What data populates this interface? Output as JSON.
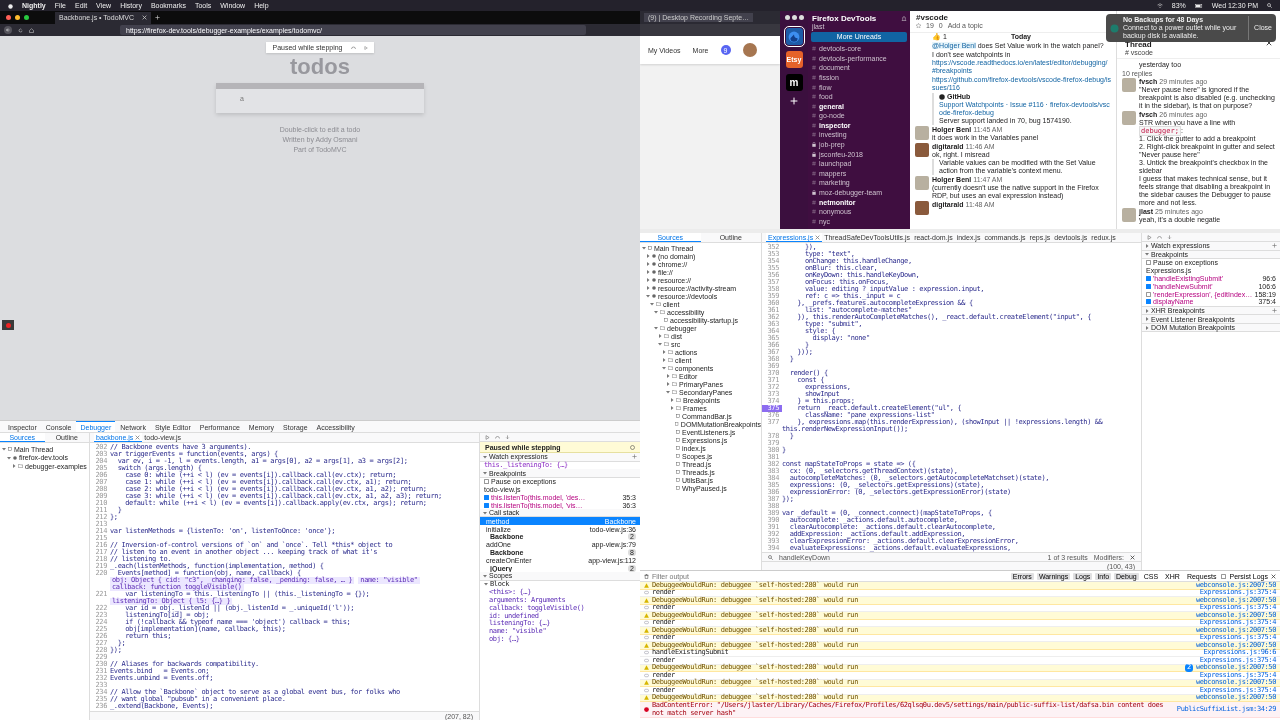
{
  "menubar": {
    "app": "Nightly",
    "menus": [
      "File",
      "Edit",
      "View",
      "History",
      "Bookmarks",
      "Tools",
      "Window",
      "Help"
    ],
    "battery": "83%",
    "clock": "Wed 12:30 PM"
  },
  "notification": {
    "title": "No Backups for 48 Days",
    "body": "Connect to a power outlet while your backup disk is available.",
    "button": "Close"
  },
  "browser": {
    "tab": "Backbone.js • TodoMVC",
    "url": "https://firefox-dev.tools/debugger-examples/examples/todomvc/",
    "paused_overlay": "Paused while stepping",
    "heading": "todos",
    "input_value": "a",
    "footer": [
      "Double-click to edit a todo",
      "Written by Addy Osmani",
      "Part of TodoMVC"
    ]
  },
  "toolbox": {
    "tabs": [
      {
        "label": "Inspector",
        "selected": false
      },
      {
        "label": "Console",
        "selected": false
      },
      {
        "label": "Debugger",
        "selected": true
      },
      {
        "label": "Network",
        "selected": false
      },
      {
        "label": "Style Editor",
        "selected": false
      },
      {
        "label": "Performance",
        "selected": false
      },
      {
        "label": "Memory",
        "selected": false
      },
      {
        "label": "Storage",
        "selected": false
      },
      {
        "label": "Accessibility",
        "selected": false
      }
    ],
    "sources_tabs": [
      {
        "label": "Sources",
        "selected": true
      },
      {
        "label": "Outline",
        "selected": false
      }
    ],
    "tree": [
      {
        "label": "Main Thread",
        "kind": "thread",
        "expanded": true,
        "children": [
          {
            "label": "firefox-dev.tools",
            "kind": "domain",
            "expanded": true,
            "children": [
              {
                "label": "debugger-examples",
                "kind": "folder",
                "expanded": false
              }
            ]
          }
        ]
      }
    ],
    "editor_tabs": [
      {
        "label": "backbone.js",
        "selected": true
      },
      {
        "label": "todo-view.js",
        "selected": false
      }
    ],
    "lines": [
      {
        "n": "202",
        "t": "// Backbone events have 3 arguments)."
      },
      {
        "n": "203",
        "t": "var triggerEvents = function(events, args) {"
      },
      {
        "n": "204",
        "t": "  var ev, i = -1, l = events.length, a1 = args[0], a2 = args[1], a3 = args[2];"
      },
      {
        "n": "205",
        "t": "  switch (args.length) {"
      },
      {
        "n": "206",
        "t": "    case 0: while (++i < l) (ev = events[i]).callback.call(ev.ctx); return;"
      },
      {
        "n": "207",
        "t": "    case 1: while (++i < l) (ev = events[i]).callback.call(ev.ctx, a1); return;"
      },
      {
        "n": "208",
        "t": "    case 2: while (++i < l) (ev = events[i]).callback.call(ev.ctx, a1, a2); return;"
      },
      {
        "n": "209",
        "t": "    case 3: while (++i < l) (ev = events[i]).callback.call(ev.ctx, a1, a2, a3); return;"
      },
      {
        "n": "210",
        "t": "    default: while (++i < l) (ev = events[i]).callback.apply(ev.ctx, args); return;"
      },
      {
        "n": "211",
        "t": "  }"
      },
      {
        "n": "212",
        "t": "};"
      },
      {
        "n": "213"
      },
      {
        "n": "214",
        "t": "var listenMethods = {listenTo: 'on', listenToOnce: 'once'};"
      },
      {
        "n": "215"
      },
      {
        "n": "216",
        "t": "// Inversion-of-control versions of `on` and `once`. Tell *this* object to"
      },
      {
        "n": "217",
        "t": "// listen to an event in another object ... keeping track of what it's"
      },
      {
        "n": "218",
        "t": "// listening to."
      },
      {
        "n": "219",
        "t": "_.each(listenMethods, function(implementation, method) {"
      },
      {
        "n": "220",
        "t": "  Events[method] = function(obj, name, callback) {",
        "previews": [
          "obj: Object { cid: \"c3\", _changing: false, _pending: false, … }",
          "name: \"visible\"",
          "callback: function toggleVisible()"
        ]
      },
      {
        "n": "221",
        "t": "    var listeningTo = this._listeningTo || (this._listeningTo = {});",
        "previews": [
          "listeningTo: Object { l5: {…} }"
        ]
      },
      {
        "n": "222",
        "t": "    var id = obj._listenId || (obj._listenId = _.uniqueId('l'));"
      },
      {
        "n": "223",
        "t": "    listeningTo[id] = obj;"
      },
      {
        "n": "224",
        "t": "    if (!callback && typeof name === 'object') callback = this;"
      },
      {
        "n": "225",
        "t": "    obj[implementation](name, callback, this);"
      },
      {
        "n": "226",
        "t": "    return this;"
      },
      {
        "n": "227",
        "t": "  };"
      },
      {
        "n": "228",
        "t": "});"
      },
      {
        "n": "229"
      },
      {
        "n": "230",
        "t": "// Aliases for backwards compatibility."
      },
      {
        "n": "231",
        "t": "Events.bind   = Events.on;"
      },
      {
        "n": "232",
        "t": "Events.unbind = Events.off;"
      },
      {
        "n": "233"
      },
      {
        "n": "234",
        "t": "// Allow the `Backbone` object to serve as a global event bus, for folks who"
      },
      {
        "n": "235",
        "t": "// want global \"pubsub\" in a convenient place."
      },
      {
        "n": "236",
        "t": "_.extend(Backbone, Events);"
      }
    ],
    "cursor": "(207, 82)",
    "pause_banner": "Paused while stepping",
    "watch": {
      "title": "Watch expressions",
      "items": [
        "this._listeningTo: {…}"
      ]
    },
    "breakpoints": {
      "title": "Breakpoints",
      "pause_label": "Pause on exceptions",
      "pause_checked": false,
      "file": "todo-view.js",
      "items": [
        {
          "text": "this.listenTo(this.model, 'des…",
          "loc": "35:3",
          "checked": true
        },
        {
          "text": "this.listenTo(this.model, 'vis…",
          "loc": "36:3",
          "checked": true
        }
      ]
    },
    "callstack": {
      "title": "Call stack",
      "frames": [
        {
          "name": "method",
          "loc": "Backbone",
          "kind": "group",
          "selected": true
        },
        {
          "name": "initialize",
          "loc": "todo-view.js:36",
          "kind": "frame",
          "selected": false
        },
        {
          "name": "Backbone",
          "loc": "2",
          "kind": "group",
          "selected": false
        },
        {
          "name": "addOne",
          "loc": "app-view.js:79",
          "kind": "frame",
          "selected": false
        },
        {
          "name": "Backbone",
          "loc": "8",
          "kind": "group",
          "selected": false
        },
        {
          "name": "createOnEnter",
          "loc": "app-view.js:112",
          "kind": "frame",
          "selected": false
        },
        {
          "name": "jQuery",
          "loc": "2",
          "kind": "group",
          "selected": false
        }
      ]
    },
    "scopes": {
      "title": "Scopes",
      "block": "Block",
      "items": [
        "<this>: {…}",
        "arguments: Arguments",
        "callback: toggleVisible()",
        "id: undefined",
        "listeningTo: {…}",
        "name: \"visible\"",
        "obj: {…}"
      ]
    }
  },
  "browser2": {
    "tab": "(9) | Desktop Recording Septe…",
    "links": [
      "My Videos",
      "More"
    ],
    "badge": "9"
  },
  "slack": {
    "workspace": "Firefox DevTools",
    "user": "jlast",
    "rail": [
      {
        "kind": "logo",
        "selected": true
      },
      {
        "label": "Etsy",
        "kind": "letter",
        "selected": false
      },
      {
        "label": "m",
        "kind": "letter",
        "selected": false
      }
    ],
    "more_unreads": "More Unreads",
    "channels": [
      {
        "name": "devtools-core",
        "unread": false,
        "private": false
      },
      {
        "name": "devtools-performance",
        "unread": false,
        "private": false
      },
      {
        "name": "document",
        "unread": false,
        "private": false
      },
      {
        "name": "fission",
        "unread": false,
        "private": false
      },
      {
        "name": "flow",
        "unread": false,
        "private": false
      },
      {
        "name": "food",
        "unread": false,
        "private": false
      },
      {
        "name": "general",
        "unread": true,
        "private": false
      },
      {
        "name": "go-node",
        "unread": false,
        "private": false
      },
      {
        "name": "inspector",
        "unread": true,
        "private": false
      },
      {
        "name": "investing",
        "unread": false,
        "private": false
      },
      {
        "name": "job-prep",
        "unread": false,
        "private": true
      },
      {
        "name": "jsconfeu-2018",
        "unread": false,
        "private": true
      },
      {
        "name": "launchpad",
        "unread": false,
        "private": false
      },
      {
        "name": "mappers",
        "unread": false,
        "private": false
      },
      {
        "name": "marketing",
        "unread": false,
        "private": false
      },
      {
        "name": "moz-debugger-team",
        "unread": false,
        "private": true
      },
      {
        "name": "netmonitor",
        "unread": true,
        "private": false
      },
      {
        "name": "nonymous",
        "unread": false,
        "private": false
      },
      {
        "name": "nyc",
        "unread": false,
        "private": false
      }
    ],
    "channel": {
      "name": "#vscode",
      "members": "19",
      "pins": "0",
      "topic": "Add a topic",
      "day": "Today",
      "reaction": "👍 1"
    },
    "messages": [
      {
        "parts": [
          {
            "kind": "mention",
            "text": "@Holger Benl"
          },
          {
            "kind": "text",
            "text": "does Set Value work in the watch panel?"
          }
        ]
      },
      {
        "parts": [
          {
            "kind": "text",
            "text": "I don't see watchpoints in"
          },
          {
            "kind": "link",
            "text": "https://vscode.readthedocs.io/en/latest/editor/debugging/#breakpoints"
          }
        ]
      },
      {
        "parts": [
          {
            "kind": "link",
            "text": "https://github.com/firefox-devtools/vscode-firefox-debug/issues/116"
          }
        ]
      },
      {
        "parts": [
          {
            "kind": "attachment",
            "source": "GitHub",
            "text": "Support Watchpoints · Issue #116 · firefox-devtools/vscode-firefox-debug",
            "note": "Server support landed in 70, bug 1574190."
          }
        ]
      },
      {
        "author": "Holger Benl",
        "time": "11:45 AM",
        "parts": [
          {
            "kind": "text",
            "text": "it does work in the Variables panel"
          }
        ]
      },
      {
        "author": "digitarald",
        "time": "11:46 AM",
        "parts": [
          {
            "kind": "text",
            "text": "ok, right. I misread"
          },
          {
            "kind": "quote",
            "text": "Variable values can be modified with the Set Value action from the variable's context menu."
          }
        ]
      },
      {
        "author": "Holger Benl",
        "time": "11:47 AM",
        "parts": [
          {
            "kind": "text",
            "text": "(currently doesn't use the native support in the Firefox RDP, but uses an eval expression instead)"
          }
        ]
      },
      {
        "author": "digitarald",
        "time": "11:48 AM"
      }
    ],
    "thread": {
      "title": "Thread",
      "channel": "# vscode",
      "prev": "yesterday too",
      "replies_count": "10 replies",
      "replies": [
        {
          "author": "fvsch",
          "time": "29 minutes ago",
          "paras": [
            [
              {
                "kind": "text",
                "text": "\"Never pause here\" is ignored if the breakpoint is also disabled (e.g. unchecking it in the sidebar), is that on purpose?"
              }
            ]
          ]
        },
        {
          "author": "fvsch",
          "time": "26 minutes ago",
          "paras": [
            [
              {
                "kind": "text",
                "text": "STR when you have a line with"
              },
              {
                "kind": "code",
                "text": "debugger;"
              },
              {
                "kind": "text",
                "text": ":"
              }
            ],
            [
              {
                "kind": "text",
                "text": "1. Click the gutter to add a breakpoint"
              }
            ],
            [
              {
                "kind": "text",
                "text": "2. Right-click breakpoint in gutter and select \"Never pause here\""
              }
            ],
            [
              {
                "kind": "text",
                "text": "3. Untick the breakpoint's checkbox in the sidebar"
              }
            ],
            [
              {
                "kind": "text",
                "text": "I guess that makes technical sense, but it feels strange that disabling a breakpoint in the sidebar causes the Debugger to pause more and not less."
              }
            ]
          ]
        },
        {
          "author": "jlast",
          "time": "25 minutes ago",
          "paras": [
            [
              {
                "kind": "text",
                "text": "yeah, it's a double negatie"
              }
            ]
          ]
        }
      ]
    }
  },
  "devtools": {
    "sources_tabs": [
      {
        "label": "Sources",
        "selected": true
      },
      {
        "label": "Outline",
        "selected": false
      }
    ],
    "tree": [
      {
        "label": "Main Thread",
        "kind": "thread",
        "expanded": true,
        "children": [
          {
            "label": "(no domain)",
            "kind": "domain",
            "expanded": false
          },
          {
            "label": "chrome://",
            "kind": "domain",
            "expanded": false
          },
          {
            "label": "file://",
            "kind": "domain",
            "expanded": false
          },
          {
            "label": "resource://",
            "kind": "domain",
            "expanded": false
          },
          {
            "label": "resource://activity-stream",
            "kind": "domain",
            "expanded": false
          },
          {
            "label": "resource://devtools",
            "kind": "domain",
            "expanded": true,
            "children": [
              {
                "label": "client",
                "kind": "folder",
                "expanded": true,
                "children": [
                  {
                    "label": "accessibility",
                    "kind": "folder",
                    "expanded": true,
                    "children": [
                      {
                        "label": "accessibility-startup.js",
                        "kind": "file"
                      }
                    ]
                  },
                  {
                    "label": "debugger",
                    "kind": "folder",
                    "expanded": true,
                    "children": [
                      {
                        "label": "dist",
                        "kind": "folder",
                        "expanded": false
                      },
                      {
                        "label": "src",
                        "kind": "folder",
                        "expanded": true,
                        "children": [
                          {
                            "label": "actions",
                            "kind": "folder",
                            "expanded": false
                          },
                          {
                            "label": "client",
                            "kind": "folder",
                            "expanded": false
                          },
                          {
                            "label": "components",
                            "kind": "folder",
                            "expanded": true,
                            "children": [
                              {
                                "label": "Editor",
                                "kind": "folder",
                                "expanded": false
                              },
                              {
                                "label": "PrimaryPanes",
                                "kind": "folder",
                                "expanded": false
                              },
                              {
                                "label": "SecondaryPanes",
                                "kind": "folder",
                                "expanded": true,
                                "children": [
                                  {
                                    "label": "Breakpoints",
                                    "kind": "folder",
                                    "expanded": false
                                  },
                                  {
                                    "label": "Frames",
                                    "kind": "folder",
                                    "expanded": false
                                  },
                                  {
                                    "label": "CommandBar.js",
                                    "kind": "file"
                                  },
                                  {
                                    "label": "DOMMutationBreakpoints",
                                    "kind": "file"
                                  },
                                  {
                                    "label": "EventListeners.js",
                                    "kind": "file"
                                  },
                                  {
                                    "label": "Expressions.js",
                                    "kind": "file"
                                  },
                                  {
                                    "label": "index.js",
                                    "kind": "file"
                                  },
                                  {
                                    "label": "Scopes.js",
                                    "kind": "file"
                                  },
                                  {
                                    "label": "Thread.js",
                                    "kind": "file"
                                  },
                                  {
                                    "label": "Threads.js",
                                    "kind": "file"
                                  },
                                  {
                                    "label": "UtilsBar.js",
                                    "kind": "file"
                                  },
                                  {
                                    "label": "WhyPaused.js",
                                    "kind": "file"
                                  }
                                ]
                              }
                            ]
                          }
                        ]
                      }
                    ]
                  }
                ]
              }
            ]
          }
        ]
      }
    ],
    "editor_tabs": [
      {
        "label": "Expressions.js",
        "selected": true
      },
      {
        "label": "ThreadSafeDevToolsUtils.js",
        "selected": false
      },
      {
        "label": "react-dom.js",
        "selected": false
      },
      {
        "label": "index.js",
        "selected": false
      },
      {
        "label": "commands.js",
        "selected": false
      },
      {
        "label": "reps.js",
        "selected": false
      },
      {
        "label": "devtools.js",
        "selected": false
      },
      {
        "label": "redux.js",
        "selected": false
      }
    ],
    "lines": [
      {
        "n": "352",
        "t": "      }),",
        "breakpoint": false
      },
      {
        "n": "353",
        "t": "      type: \"text\",",
        "breakpoint": false
      },
      {
        "n": "354",
        "t": "      onChange: this.handleChange,",
        "breakpoint": false
      },
      {
        "n": "355",
        "t": "      onBlur: this.clear,",
        "breakpoint": false
      },
      {
        "n": "356",
        "t": "      onKeyDown: this.handleKeyDown,",
        "breakpoint": false
      },
      {
        "n": "357",
        "t": "      onFocus: this.onFocus,",
        "breakpoint": false
      },
      {
        "n": "358",
        "t": "      value: editing ? inputValue : expression.input,",
        "breakpoint": false
      },
      {
        "n": "359",
        "t": "      ref: c => this._input = c",
        "breakpoint": false
      },
      {
        "n": "360",
        "t": "    }, _prefs.features.autocompleteExpression && {",
        "breakpoint": false
      },
      {
        "n": "361",
        "t": "      list: \"autocomplete-matches\"",
        "breakpoint": false
      },
      {
        "n": "362",
        "t": "    }), this.renderAutoCompleteMatches(), _react.default.createElement(\"input\", {",
        "breakpoint": false
      },
      {
        "n": "363",
        "t": "      type: \"submit\",",
        "breakpoint": false
      },
      {
        "n": "364",
        "t": "      style: {",
        "breakpoint": false
      },
      {
        "n": "365",
        "t": "        display: \"none\"",
        "breakpoint": false
      },
      {
        "n": "366",
        "t": "      }",
        "breakpoint": false
      },
      {
        "n": "367",
        "t": "    }));",
        "breakpoint": false
      },
      {
        "n": "368",
        "t": "  }",
        "breakpoint": false
      },
      {
        "n": "369",
        "breakpoint": false
      },
      {
        "n": "370",
        "t": "  render() {",
        "breakpoint": false
      },
      {
        "n": "371",
        "t": "    const {",
        "breakpoint": false
      },
      {
        "n": "372",
        "t": "      expressions,",
        "breakpoint": false
      },
      {
        "n": "373",
        "t": "      showInput",
        "breakpoint": false
      },
      {
        "n": "374",
        "t": "    } = this.props;",
        "breakpoint": false
      },
      {
        "n": "375",
        "t": "    return _react.default.createElement(\"ul\", {",
        "breakpoint": true
      },
      {
        "n": "376",
        "t": "      className: \"pane expressions-list\"",
        "breakpoint": false
      },
      {
        "n": "377",
        "t": "    }, expressions.map(this.renderExpression), (showInput || !expressions.length) && this.renderNewExpressionInput());",
        "breakpoint": false
      },
      {
        "n": "378",
        "t": "  }",
        "breakpoint": false
      },
      {
        "n": "379",
        "breakpoint": false
      },
      {
        "n": "380",
        "t": "}",
        "breakpoint": false
      },
      {
        "n": "381",
        "breakpoint": false
      },
      {
        "n": "382",
        "t": "const mapStateToProps = state => ({",
        "breakpoint": false
      },
      {
        "n": "383",
        "t": "  cx: (0, _selectors.getThreadContext)(state),",
        "breakpoint": false
      },
      {
        "n": "384",
        "t": "  autocompleteMatches: (0, _selectors.getAutocompleteMatchset)(state),",
        "breakpoint": false
      },
      {
        "n": "385",
        "t": "  expressions: (0, _selectors.getExpressions)(state),",
        "breakpoint": false
      },
      {
        "n": "386",
        "t": "  expressionError: (0, _selectors.getExpressionError)(state)",
        "breakpoint": false
      },
      {
        "n": "387",
        "t": "});",
        "breakpoint": false
      },
      {
        "n": "388",
        "breakpoint": false
      },
      {
        "n": "389",
        "t": "var _default = (0, _connect.connect)(mapStateToProps, {",
        "breakpoint": false
      },
      {
        "n": "390",
        "t": "  autocomplete: _actions.default.autocomplete,",
        "breakpoint": false
      },
      {
        "n": "391",
        "t": "  clearAutocomplete: _actions.default.clearAutocomplete,",
        "breakpoint": false
      },
      {
        "n": "392",
        "t": "  addExpression: _actions.default.addExpression,",
        "breakpoint": false
      },
      {
        "n": "393",
        "t": "  clearExpressionError: _actions.default.clearExpressionError,",
        "breakpoint": false
      },
      {
        "n": "394",
        "t": "  evaluateExpressions: _actions.default.evaluateExpressions,",
        "breakpoint": false
      }
    ],
    "search": {
      "value": "handleKeyDown",
      "results": "1 of 3 results",
      "modifiers": "Modifiers:"
    },
    "cursor": "(100, 43)",
    "sections": {
      "watch": "Watch expressions",
      "breakpoints": "Breakpoints",
      "pause_label": "Pause on exceptions",
      "pause_checked": false,
      "file": "Expressions.js",
      "items": [
        {
          "text": "'handleExistingSubmit'",
          "loc": "96:6",
          "checked": true
        },
        {
          "text": "'handleNewSubmit'",
          "loc": "106:6",
          "checked": true
        },
        {
          "text": "'renderExpression', {editIndex…",
          "loc": "158:19",
          "checked": false
        },
        {
          "text": "displayName",
          "loc": "375:4",
          "checked": true
        }
      ],
      "collapsed": [
        "XHR Breakpoints",
        "Event Listener Breakpoints",
        "DOM Mutation Breakpoints"
      ]
    }
  },
  "console": {
    "filter_placeholder": "Filter output",
    "filters": [
      {
        "label": "Errors",
        "selected": true
      },
      {
        "label": "Warnings",
        "selected": true
      },
      {
        "label": "Logs",
        "selected": true
      },
      {
        "label": "Info",
        "selected": true
      },
      {
        "label": "Debug",
        "selected": true
      },
      {
        "label": "CSS",
        "selected": false
      },
      {
        "label": "XHR",
        "selected": false
      },
      {
        "label": "Requests",
        "selected": false
      }
    ],
    "persist": "Persist Logs",
    "persist_checked": false,
    "rows": [
      {
        "kind": "warning",
        "text": "DebuggeeWouldRun: debuggee `self-hosted:280` would run",
        "source": "webconsole.js:2007:50"
      },
      {
        "kind": "log",
        "text": "render",
        "source": "Expressions.js:375:4"
      },
      {
        "kind": "warning",
        "text": "DebuggeeWouldRun: debuggee `self-hosted:280` would run",
        "source": "webconsole.js:2007:50"
      },
      {
        "kind": "log",
        "text": "render",
        "source": "Expressions.js:375:4"
      },
      {
        "kind": "warning",
        "text": "DebuggeeWouldRun: debuggee `self-hosted:280` would run",
        "source": "webconsole.js:2007:50"
      },
      {
        "kind": "log",
        "text": "render",
        "source": "Expressions.js:375:4"
      },
      {
        "kind": "warning",
        "text": "DebuggeeWouldRun: debuggee `self-hosted:280` would run",
        "source": "webconsole.js:2007:50"
      },
      {
        "kind": "log",
        "text": "render",
        "source": "Expressions.js:375:4"
      },
      {
        "kind": "warning",
        "text": "DebuggeeWouldRun: debuggee `self-hosted:280` would run",
        "source": "webconsole.js:2007:50"
      },
      {
        "kind": "log",
        "text": "handleExistingSubmit",
        "source": "Expressions.js:96:6"
      },
      {
        "kind": "log",
        "text": "render",
        "source": "Expressions.js:375:4"
      },
      {
        "kind": "warning",
        "text": "DebuggeeWouldRun: debuggee `self-hosted:280` would run",
        "source": "webconsole.js:2007:50",
        "count": "2"
      },
      {
        "kind": "log",
        "text": "render",
        "source": "Expressions.js:375:4"
      },
      {
        "kind": "warning",
        "text": "DebuggeeWouldRun: debuggee `self-hosted:280` would run",
        "source": "webconsole.js:2007:50"
      },
      {
        "kind": "log",
        "text": "render",
        "source": "Expressions.js:375:4"
      },
      {
        "kind": "warning",
        "text": "DebuggeeWouldRun: debuggee `self-hosted:280` would run",
        "source": "webconsole.js:2007:50"
      },
      {
        "kind": "error",
        "text": "BadContentError: \"/Users/jlaster/Library/Caches/Firefox/Profiles/62qlsq0u.dev5/settings/main/public-suffix-list/dafsa.bin content does not match server hash\"",
        "source": "PublicSuffixList.jsm:34:29"
      }
    ]
  }
}
